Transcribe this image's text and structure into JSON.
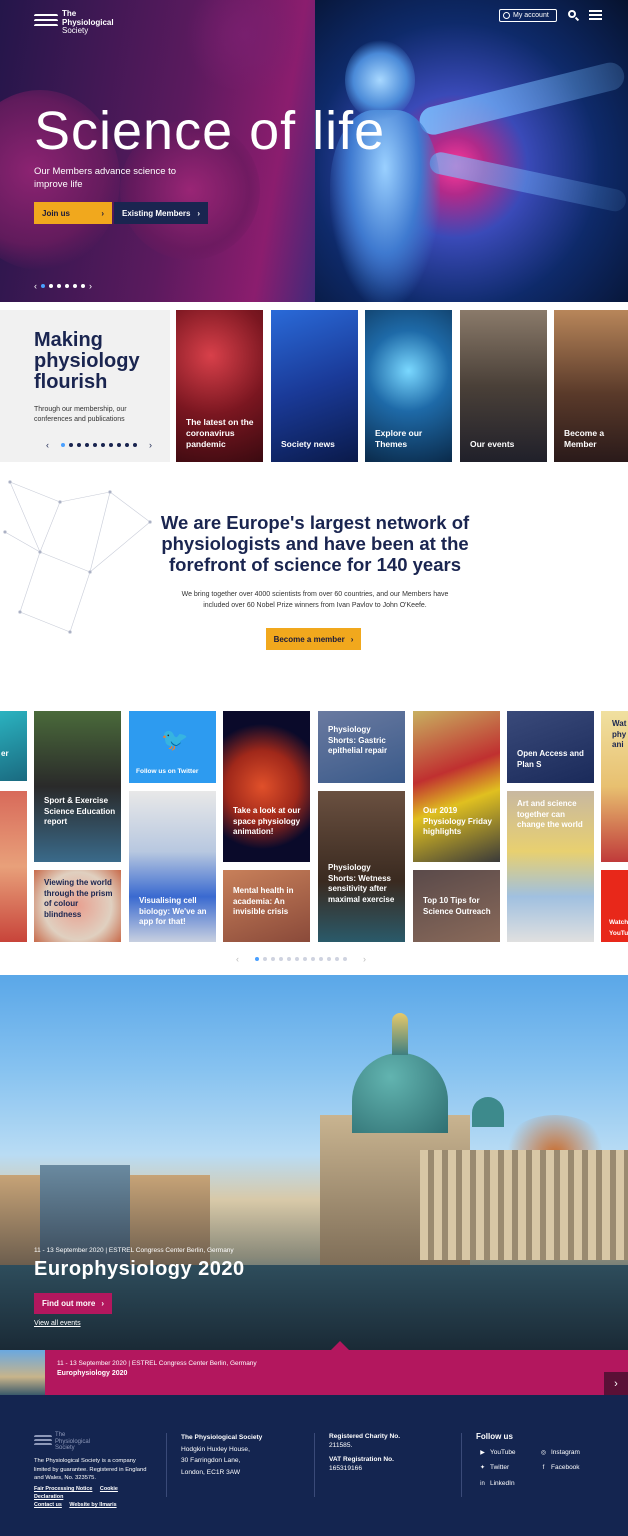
{
  "header": {
    "logo_line1": "The",
    "logo_line2": "Physiological",
    "logo_line3": "Society",
    "account_label": "My account",
    "search_icon": "search-icon",
    "menu_icon": "hamburger-menu-icon"
  },
  "hero": {
    "title": "Science of life",
    "subtitle": "Our Members advance science to improve life",
    "join_label": "Join us",
    "existing_label": "Existing Members",
    "slides": 6,
    "active_slide": 1
  },
  "flourish": {
    "title": "Making physiology flourish",
    "description": "Through our membership, our conferences and publications",
    "dots": 10,
    "active_dot": 1,
    "tiles": [
      {
        "label": "The latest on the coronavirus pandemic"
      },
      {
        "label": "Society news"
      },
      {
        "label": "Explore our Themes"
      },
      {
        "label": "Our events"
      },
      {
        "label": "Become a Member"
      }
    ]
  },
  "network": {
    "title": "We are Europe's largest network of physiologists and have been at the forefront of science for 140 years",
    "description": "We bring together over 4000 scientists from over 60 countries, and our Members have included over 60 Nobel Prize winners from Ivan Pavlov to John O'Keefe.",
    "button_label": "Become a member"
  },
  "mosaic": {
    "tiles": [
      {
        "label": "Sport & Exercise Science Education report"
      },
      {
        "label": "Viewing the world through the prism of colour blindness"
      },
      {
        "label": "Follow us on Twitter"
      },
      {
        "label": "Visualising cell biology: We've an app for that!"
      },
      {
        "label": "Take a look at our space physiology animation!"
      },
      {
        "label": "Mental health in academia: An invisible crisis"
      },
      {
        "label": "Physiology Shorts: Gastric epithelial repair"
      },
      {
        "label": "Physiology Shorts: Wetness sensitivity after maximal exercise"
      },
      {
        "label": "Our 2019 Physiology Friday highlights"
      },
      {
        "label": "Top 10 Tips for Science Outreach"
      },
      {
        "label": "Open Access and Plan S"
      },
      {
        "label": "Art and science together can change the world"
      },
      {
        "label": "Wat phy ani"
      },
      {
        "label": "Watch YouTu"
      },
      {
        "label": "er"
      }
    ],
    "dots": 12,
    "active_dot": 1
  },
  "event": {
    "meta": "11 - 13 September 2020 | ESTREL Congress Center Berlin, Germany",
    "title": "Europhysiology 2020",
    "button_label": "Find out more",
    "view_all": "View all events",
    "strip_meta": "11 - 13 September 2020 | ESTREL Congress Center Berlin, Germany",
    "strip_title": "Europhysiology 2020"
  },
  "footer": {
    "logo_line1": "The",
    "logo_line2": "Physiological",
    "logo_line3": "Society",
    "company_desc": "The Physiological Society is a company limited by guarantee. Registered in England and Wales, No. 323575.",
    "links": [
      "Fair Processing Notice",
      "Cookie Declaration",
      "Contact us",
      "Website by Ilmaris"
    ],
    "address_title": "The Physiological Society",
    "address": [
      "Hodgkin Huxley House,",
      "30 Farringdon Lane,",
      "London, EC1R 3AW"
    ],
    "charity_title": "Registered Charity No.",
    "charity_no": "211585.",
    "vat_title": "VAT Registration No.",
    "vat_no": "165319166",
    "follow_title": "Follow us",
    "social": [
      {
        "label": "YouTube",
        "icon": "youtube-icon"
      },
      {
        "label": "Instagram",
        "icon": "instagram-icon"
      },
      {
        "label": "Twitter",
        "icon": "twitter-icon"
      },
      {
        "label": "Facebook",
        "icon": "facebook-icon"
      },
      {
        "label": "LinkedIn",
        "icon": "linkedin-icon"
      }
    ]
  }
}
